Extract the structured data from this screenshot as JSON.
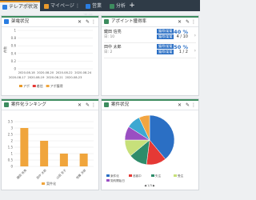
{
  "tabs": [
    {
      "label": "テレアポ状況",
      "color": "#2a7de1",
      "active": true
    },
    {
      "label": "マイページ",
      "color": "#e89a2c",
      "active": false
    },
    {
      "label": "営業進捗",
      "color": "#2a7de1",
      "active": false
    },
    {
      "label": "分析",
      "color": "#3d8c5f",
      "active": false
    }
  ],
  "tab_menu_icon": "⋮",
  "plus_label": "+",
  "panels": {
    "p1": {
      "title": "架電状況",
      "icon_color": "#2a7de1"
    },
    "p2": {
      "title": "アポイント獲得率",
      "icon_color": "#3d8c5f"
    },
    "p3": {
      "title": "案件化ランキング",
      "icon_color": "#3d8c5f"
    },
    "p4": {
      "title": "案件状況",
      "icon_color": "#3d8c5f"
    }
  },
  "controls": {
    "close": "✕",
    "edit": "✎",
    "menu": "⋮"
  },
  "colors": {
    "accent": "#3d8c5f",
    "orange": "#e89a2c",
    "red": "#e53935",
    "bar": "#f0a53c",
    "blue": "#2b6fc4"
  },
  "apo_rows": [
    {
      "name": "鍵田 信亮",
      "date": "日: 10",
      "badge": "獲得/架電",
      "pct": "40 %",
      "value": "4 / 10"
    },
    {
      "name": "田中 太郎",
      "date": "日: 2",
      "badge": "獲得/架電",
      "pct": "50 %",
      "value": "1 / 2"
    }
  ],
  "chart_data": [
    {
      "type": "bar",
      "categories": [
        "2020-08-17",
        "2020-08-18",
        "2020-08-19",
        "2020-08-20",
        "2020-08-21",
        "2020-08-22",
        "2020-08-23",
        "2020-08-24"
      ],
      "yticks": [
        "0",
        "0.2",
        "0.4",
        "0.6",
        "0.8",
        "1"
      ],
      "ylim": [
        0,
        1
      ],
      "ylabel": "件数",
      "series": [
        {
          "name": "アポ",
          "color": "#e89a2c",
          "values": [
            0,
            0,
            0,
            0,
            0,
            0,
            0,
            0
          ]
        },
        {
          "name": "着信",
          "color": "#e53935",
          "values": [
            0,
            0,
            0,
            0,
            0,
            0,
            0,
            0
          ]
        },
        {
          "name": "アポ獲得",
          "color": "#f0a53c",
          "values": [
            0,
            0,
            0,
            0,
            0,
            0,
            0,
            0
          ]
        }
      ]
    },
    {
      "type": "bar",
      "categories": [
        "鍵田 信亮",
        "田中 太郎",
        "山田 花子",
        "佐藤 次郎"
      ],
      "values": [
        3,
        2,
        1,
        1
      ],
      "yticks": [
        "0",
        "0.5",
        "1",
        "1.5",
        "2",
        "2.5",
        "3",
        "3.5"
      ],
      "ylim": [
        0,
        3.5
      ],
      "series": [
        {
          "name": "案件化",
          "color": "#f0a53c"
        }
      ]
    },
    {
      "type": "pie",
      "slices": [
        {
          "name": "案件化",
          "value": 39,
          "color": "#2b6fc4"
        },
        {
          "name": "追客中",
          "value": 13,
          "color": "#e53935"
        },
        {
          "name": "失注",
          "value": 12,
          "color": "#2e8c6a"
        },
        {
          "name": "受注",
          "value": 11,
          "color": "#c7e07a"
        },
        {
          "name": "保留",
          "value": 9,
          "color": "#9a4fc2"
        },
        {
          "name": "検討中",
          "value": 9,
          "color": "#3ea8d2"
        },
        {
          "name": "その他",
          "value": 7,
          "color": "#f2a541"
        }
      ],
      "legend_label": "契約開始日",
      "legend_count": "1/3"
    }
  ]
}
